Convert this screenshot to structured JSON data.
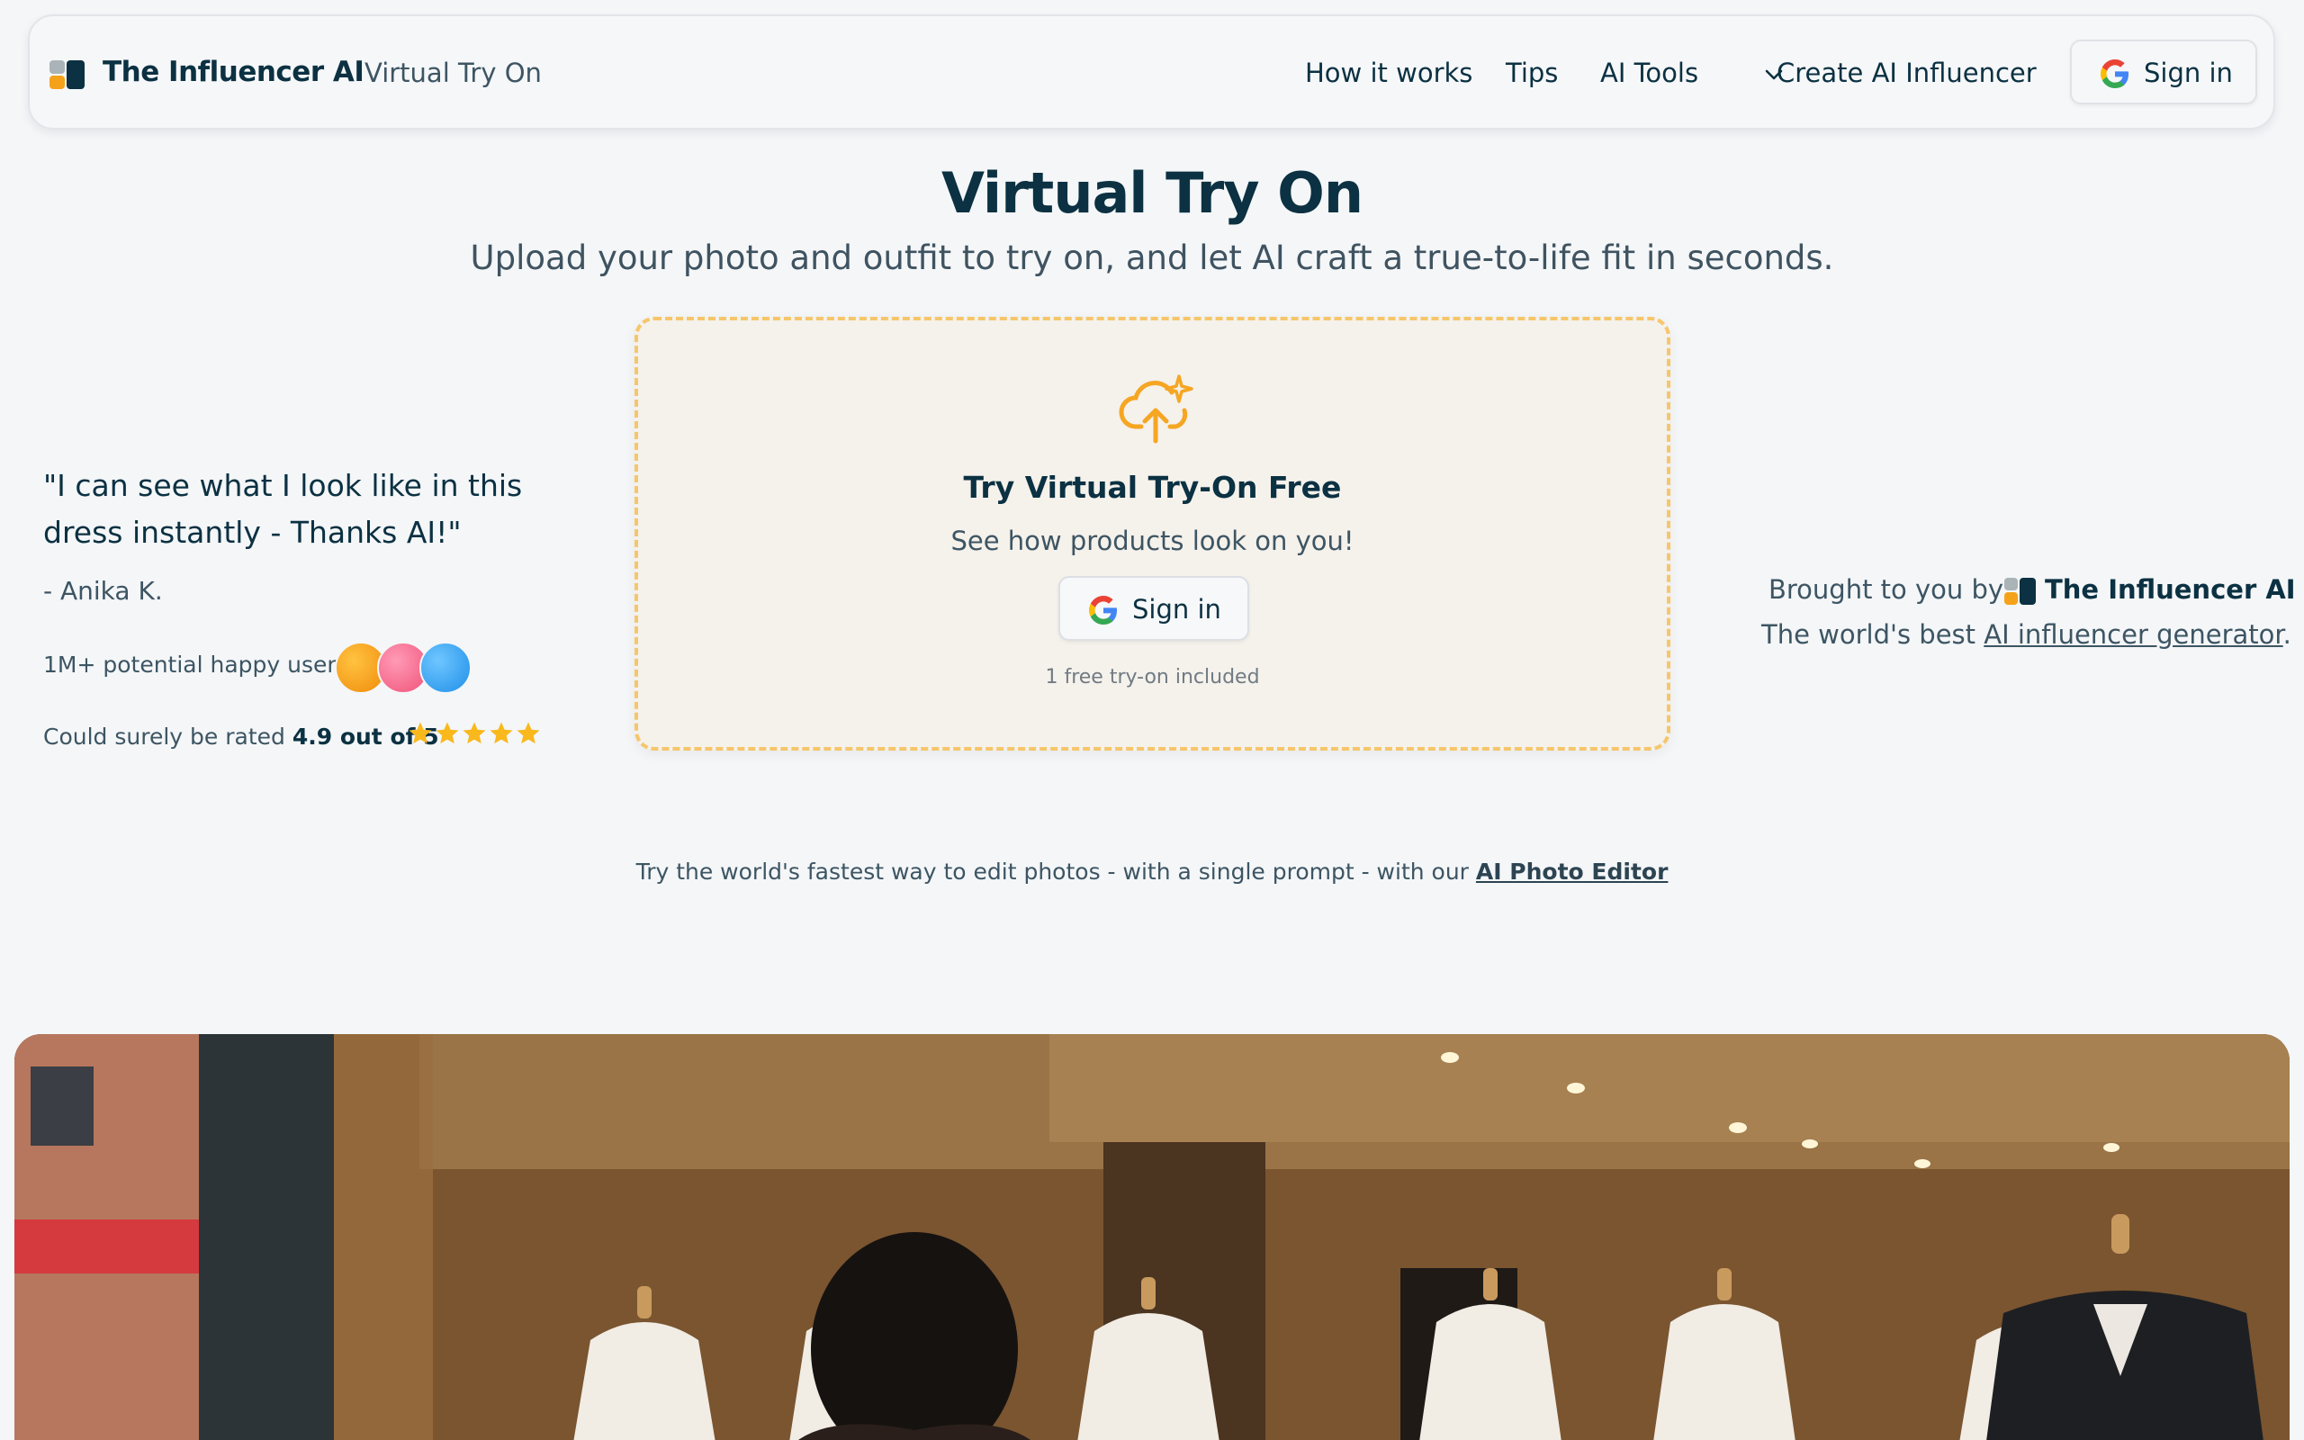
{
  "header": {
    "brand_name": "The Influencer AI",
    "brand_subtitle": "Virtual Try On",
    "nav": [
      {
        "label": "How it works"
      },
      {
        "label": "Tips"
      },
      {
        "label": "AI Tools"
      },
      {
        "label": "Create AI Influencer"
      }
    ],
    "signin_label": "Sign in"
  },
  "hero": {
    "title": "Virtual Try On",
    "subtitle": "Upload your photo and outfit to try on, and let AI craft a true-to-life fit in seconds."
  },
  "upload_card": {
    "icon": "cloud-upload-sparkle-icon",
    "title": "Try Virtual Try-On Free",
    "subtitle": "See how products look on you!",
    "signin_label": "Sign in",
    "note": "1 free try-on included"
  },
  "testimonial": {
    "quote": "\"I can see what I look like in this dress instantly - Thanks AI!\"",
    "author": "- Anika K.",
    "users_text": "1M+ potential happy users",
    "rating_prefix": "Could surely be rated",
    "rating_value": "4.9 out of 5",
    "stars": 5
  },
  "credit": {
    "brought_by": "Brought to you by",
    "brand": "The Influencer AI",
    "worlds_best_prefix": "The world's best",
    "generator_link": "AI influencer generator",
    "period": "."
  },
  "editor_line": {
    "text": "Try the world's fastest way to edit photos - with a single prompt - with our",
    "link": "AI Photo Editor"
  },
  "colors": {
    "navy": "#0b3142",
    "accent_orange": "#f5a21b",
    "dash_border": "#f6c66b",
    "star_gold": "#f9b81c",
    "page_bg": "#f4f6f8"
  }
}
